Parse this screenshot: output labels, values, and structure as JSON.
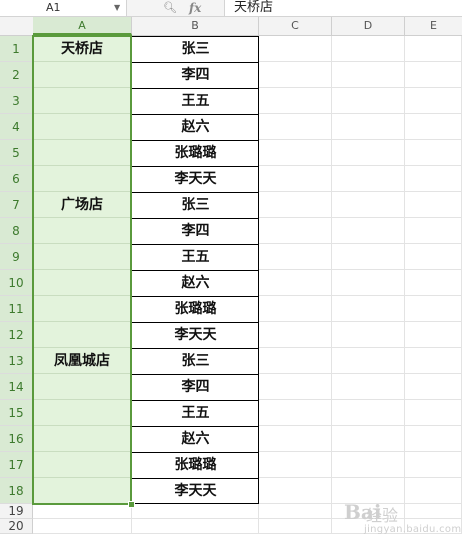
{
  "formula_bar": {
    "name_box": "A1",
    "fx_label": "fx",
    "content": "天桥店"
  },
  "columns": [
    "A",
    "B",
    "C",
    "D",
    "E"
  ],
  "rows": [
    "1",
    "2",
    "3",
    "4",
    "5",
    "6",
    "7",
    "8",
    "9",
    "10",
    "11",
    "12",
    "13",
    "14",
    "15",
    "16",
    "17",
    "18",
    "19",
    "20"
  ],
  "column_a_groups": [
    {
      "row": 1,
      "text": "天桥店"
    },
    {
      "row": 7,
      "text": "广场店"
    },
    {
      "row": 13,
      "text": "凤凰城店"
    }
  ],
  "column_b": [
    "张三",
    "李四",
    "王五",
    "赵六",
    "张璐璐",
    "李天天",
    "张三",
    "李四",
    "王五",
    "赵六",
    "张璐璐",
    "李天天",
    "张三",
    "李四",
    "王五",
    "赵六",
    "张璐璐",
    "李天天"
  ],
  "watermark": {
    "brand": "Bai",
    "name": "经验",
    "url": "jingyan.baidu.com"
  },
  "colors": {
    "selection": "#5a9a3c",
    "selected_fill": "#e3f3dc",
    "header_selected": "#d9ead3"
  }
}
